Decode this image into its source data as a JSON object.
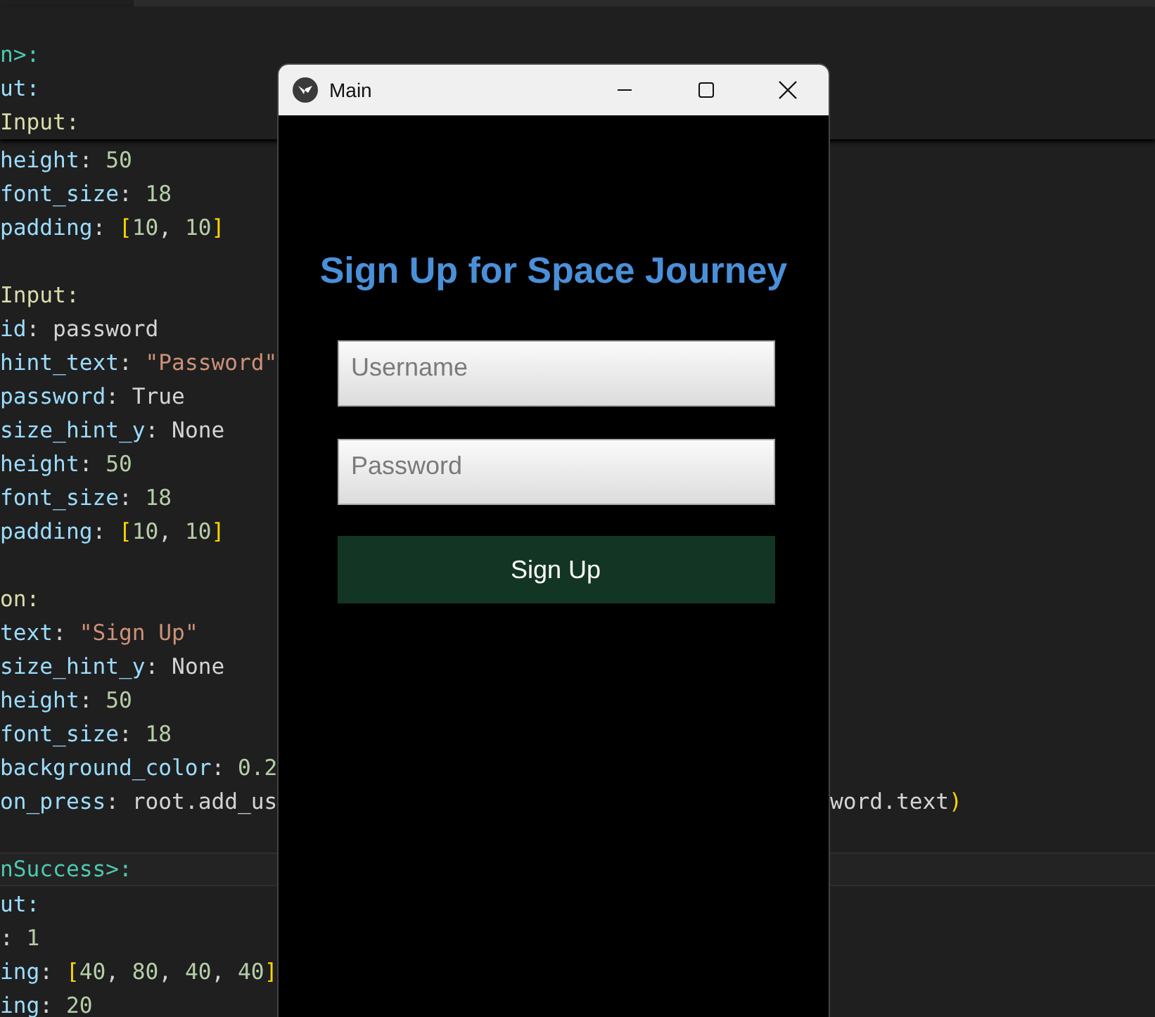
{
  "editor": {
    "sticky_lines": [
      [
        {
          "text": "n>:",
          "kind": "tag"
        }
      ],
      [
        {
          "text": "ut:",
          "kind": "key"
        }
      ],
      [
        {
          "text": "Input:",
          "kind": "cls"
        }
      ]
    ],
    "blocks": [
      [
        {
          "left": [
            {
              "text": "height",
              "kind": "key"
            },
            {
              "text": ": ",
              "kind": "text"
            },
            {
              "text": "50",
              "kind": "num"
            }
          ]
        },
        {
          "left": [
            {
              "text": "font_size",
              "kind": "key"
            },
            {
              "text": ": ",
              "kind": "text"
            },
            {
              "text": "18",
              "kind": "num"
            }
          ]
        },
        {
          "left": [
            {
              "text": "padding",
              "kind": "key"
            },
            {
              "text": ": ",
              "kind": "text"
            },
            {
              "text": "[",
              "kind": "bracket"
            },
            {
              "text": "10",
              "kind": "num"
            },
            {
              "text": ", ",
              "kind": "text"
            },
            {
              "text": "10",
              "kind": "num"
            },
            {
              "text": "]",
              "kind": "bracket"
            }
          ]
        }
      ],
      [
        {
          "left": [
            {
              "text": "Input:",
              "kind": "cls"
            }
          ]
        },
        {
          "left": [
            {
              "text": "id",
              "kind": "key"
            },
            {
              "text": ": password",
              "kind": "text"
            }
          ]
        },
        {
          "left": [
            {
              "text": "hint_text",
              "kind": "key"
            },
            {
              "text": ": ",
              "kind": "text"
            },
            {
              "text": "\"Password\"",
              "kind": "str"
            }
          ]
        },
        {
          "left": [
            {
              "text": "password",
              "kind": "key"
            },
            {
              "text": ": True",
              "kind": "text"
            }
          ]
        },
        {
          "left": [
            {
              "text": "size_hint_y",
              "kind": "key"
            },
            {
              "text": ": None",
              "kind": "text"
            }
          ]
        },
        {
          "left": [
            {
              "text": "height",
              "kind": "key"
            },
            {
              "text": ": ",
              "kind": "text"
            },
            {
              "text": "50",
              "kind": "num"
            }
          ]
        },
        {
          "left": [
            {
              "text": "font_size",
              "kind": "key"
            },
            {
              "text": ": ",
              "kind": "text"
            },
            {
              "text": "18",
              "kind": "num"
            }
          ]
        },
        {
          "left": [
            {
              "text": "padding",
              "kind": "key"
            },
            {
              "text": ": ",
              "kind": "text"
            },
            {
              "text": "[",
              "kind": "bracket"
            },
            {
              "text": "10",
              "kind": "num"
            },
            {
              "text": ", ",
              "kind": "text"
            },
            {
              "text": "10",
              "kind": "num"
            },
            {
              "text": "]",
              "kind": "bracket"
            }
          ]
        }
      ],
      [
        {
          "left": [
            {
              "text": "on:",
              "kind": "cls"
            }
          ]
        },
        {
          "left": [
            {
              "text": "text",
              "kind": "key"
            },
            {
              "text": ": ",
              "kind": "text"
            },
            {
              "text": "\"Sign Up\"",
              "kind": "str"
            }
          ]
        },
        {
          "left": [
            {
              "text": "size_hint_y",
              "kind": "key"
            },
            {
              "text": ": None",
              "kind": "text"
            }
          ]
        },
        {
          "left": [
            {
              "text": "height",
              "kind": "key"
            },
            {
              "text": ": ",
              "kind": "text"
            },
            {
              "text": "50",
              "kind": "num"
            }
          ]
        },
        {
          "left": [
            {
              "text": "font_size",
              "kind": "key"
            },
            {
              "text": ": ",
              "kind": "text"
            },
            {
              "text": "18",
              "kind": "num"
            }
          ]
        },
        {
          "left": [
            {
              "text": "background_color",
              "kind": "key"
            },
            {
              "text": ": ",
              "kind": "text"
            },
            {
              "text": "0.2",
              "kind": "num"
            }
          ]
        },
        {
          "left": [
            {
              "text": "on_press",
              "kind": "key"
            },
            {
              "text": ": root.add_us",
              "kind": "text"
            }
          ],
          "right": [
            {
              "text": "word.text",
              "kind": "text"
            },
            {
              "text": ")",
              "kind": "bracket"
            }
          ]
        }
      ]
    ],
    "section_header": [
      {
        "text": "nSuccess>:",
        "kind": "tag"
      }
    ],
    "section_lines": [
      {
        "left": [
          {
            "text": "ut:",
            "kind": "key"
          }
        ]
      },
      {
        "left": [
          {
            "text": ": ",
            "kind": "text"
          },
          {
            "text": "1",
            "kind": "num"
          }
        ]
      },
      {
        "left": [
          {
            "text": "ing",
            "kind": "key"
          },
          {
            "text": ": ",
            "kind": "text"
          },
          {
            "text": "[",
            "kind": "bracket"
          },
          {
            "text": "40",
            "kind": "num"
          },
          {
            "text": ", ",
            "kind": "text"
          },
          {
            "text": "80",
            "kind": "num"
          },
          {
            "text": ", ",
            "kind": "text"
          },
          {
            "text": "40",
            "kind": "num"
          },
          {
            "text": ", ",
            "kind": "text"
          },
          {
            "text": "40",
            "kind": "num"
          },
          {
            "text": "]",
            "kind": "bracket"
          }
        ]
      },
      {
        "left": [
          {
            "text": "ing",
            "kind": "key"
          },
          {
            "text": ": ",
            "kind": "text"
          },
          {
            "text": "20",
            "kind": "num"
          }
        ]
      }
    ]
  },
  "window": {
    "title": "Main",
    "heading": "Sign Up for Space Journey",
    "fields": [
      {
        "placeholder": "Username"
      },
      {
        "placeholder": "Password"
      }
    ],
    "button": "Sign Up"
  }
}
